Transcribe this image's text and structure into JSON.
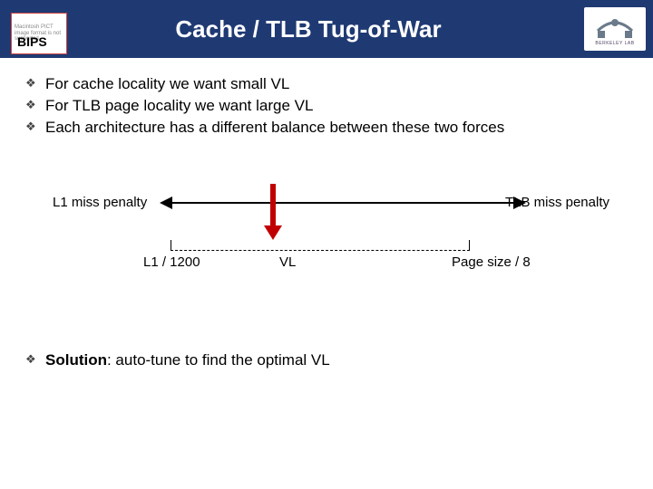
{
  "header": {
    "badge_bg_text": "Macintosh PICT image format is not supported",
    "badge_label": "BIPS",
    "title": "Cache / TLB Tug-of-War",
    "lab_label": "BERKELEY LAB"
  },
  "bullets": [
    "For cache locality we want small VL",
    "For TLB page locality we want large VL",
    "Each architecture has a different balance between these two forces"
  ],
  "diagram": {
    "left_label": "L1 miss penalty",
    "right_label": "TLB miss penalty",
    "axis_left": "L1 / 1200",
    "axis_mid": "VL",
    "axis_right": "Page size / 8"
  },
  "solution": {
    "prefix": "Solution",
    "rest": ": auto-tune to find the optimal VL"
  }
}
